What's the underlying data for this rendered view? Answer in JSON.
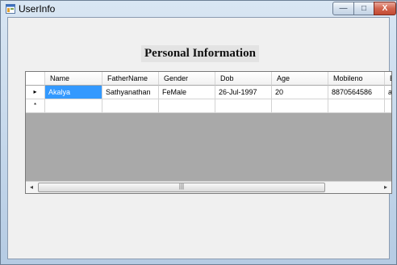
{
  "window": {
    "title": "UserInfo",
    "controls": {
      "minimize": "—",
      "maximize": "□",
      "close": "X"
    }
  },
  "form": {
    "heading": "Personal Information"
  },
  "grid": {
    "columns": [
      "Name",
      "FatherName",
      "Gender",
      "Dob",
      "Age",
      "Mobileno",
      "Em"
    ],
    "rows": [
      {
        "marker": "▸",
        "cells": [
          "Akalya",
          "Sathyanathan",
          "FeMale",
          "26-Jul-1997",
          "20",
          "8870564586",
          "ak"
        ]
      },
      {
        "marker": "*",
        "cells": [
          "",
          "",
          "",
          "",
          "",
          "",
          ""
        ]
      }
    ],
    "selected_cell": "Akalya",
    "scroll": {
      "left": "◂",
      "right": "▸",
      "thumb": "|||"
    }
  },
  "colors": {
    "selection": "#3399ff",
    "grid_background": "#a9a9a9",
    "close_button": "#c24a33"
  }
}
